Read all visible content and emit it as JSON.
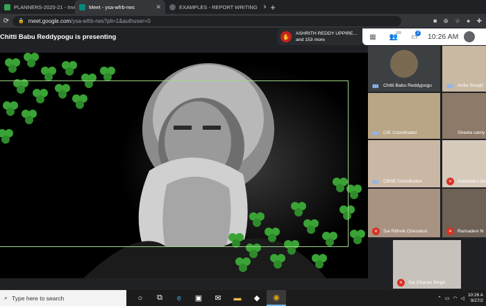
{
  "browser": {
    "tabs": [
      {
        "label": "PLANNERS-2020-21 - Invi",
        "close": "✕",
        "favicon_color": "#34a853"
      },
      {
        "label": "Meet - ysa-wfrb-rws",
        "close": "✕",
        "favicon_color": "#00897b"
      },
      {
        "label": "EXAMPLES - REPORT WRITING",
        "close": "✕",
        "favicon_color": "#5f6368"
      }
    ],
    "new_tab": "+",
    "url_host": "meet.google.com",
    "url_path": "/ysa-wfrb-rws?pli=1&authuser=0"
  },
  "meet": {
    "presenting_text": "Chitti Babu Reddypogu is presenting",
    "notification": {
      "line1": "ASHRITH REDDY UPPIRE...",
      "line2": "and 153 more"
    },
    "participant_count": "165",
    "chat_badge": "2",
    "time": "10:26 AM"
  },
  "participants": [
    {
      "name": "Chitti Babu Reddypogu",
      "muted": false
    },
    {
      "name": "Anita Sreejit",
      "muted": false
    },
    {
      "name": "CIE Coordinator",
      "muted": false
    },
    {
      "name": "Sheela samy",
      "muted": false
    },
    {
      "name": "CBSE Coordinator",
      "muted": false
    },
    {
      "name": "Aravinda Lod",
      "muted": true
    },
    {
      "name": "Sai Rithvik Cherukuri",
      "muted": true
    },
    {
      "name": "Ramadevi N",
      "muted": true
    },
    {
      "name": "Sai Charan Singh",
      "muted": true
    }
  ],
  "taskbar": {
    "search_placeholder": "Type here to search",
    "clock_time": "10:26 A",
    "clock_date": "9/27/2"
  },
  "colors": {
    "meet_bg": "#202124",
    "clover": "#3aa335",
    "accent": "#1a73e8",
    "muted_red": "#d93025"
  }
}
